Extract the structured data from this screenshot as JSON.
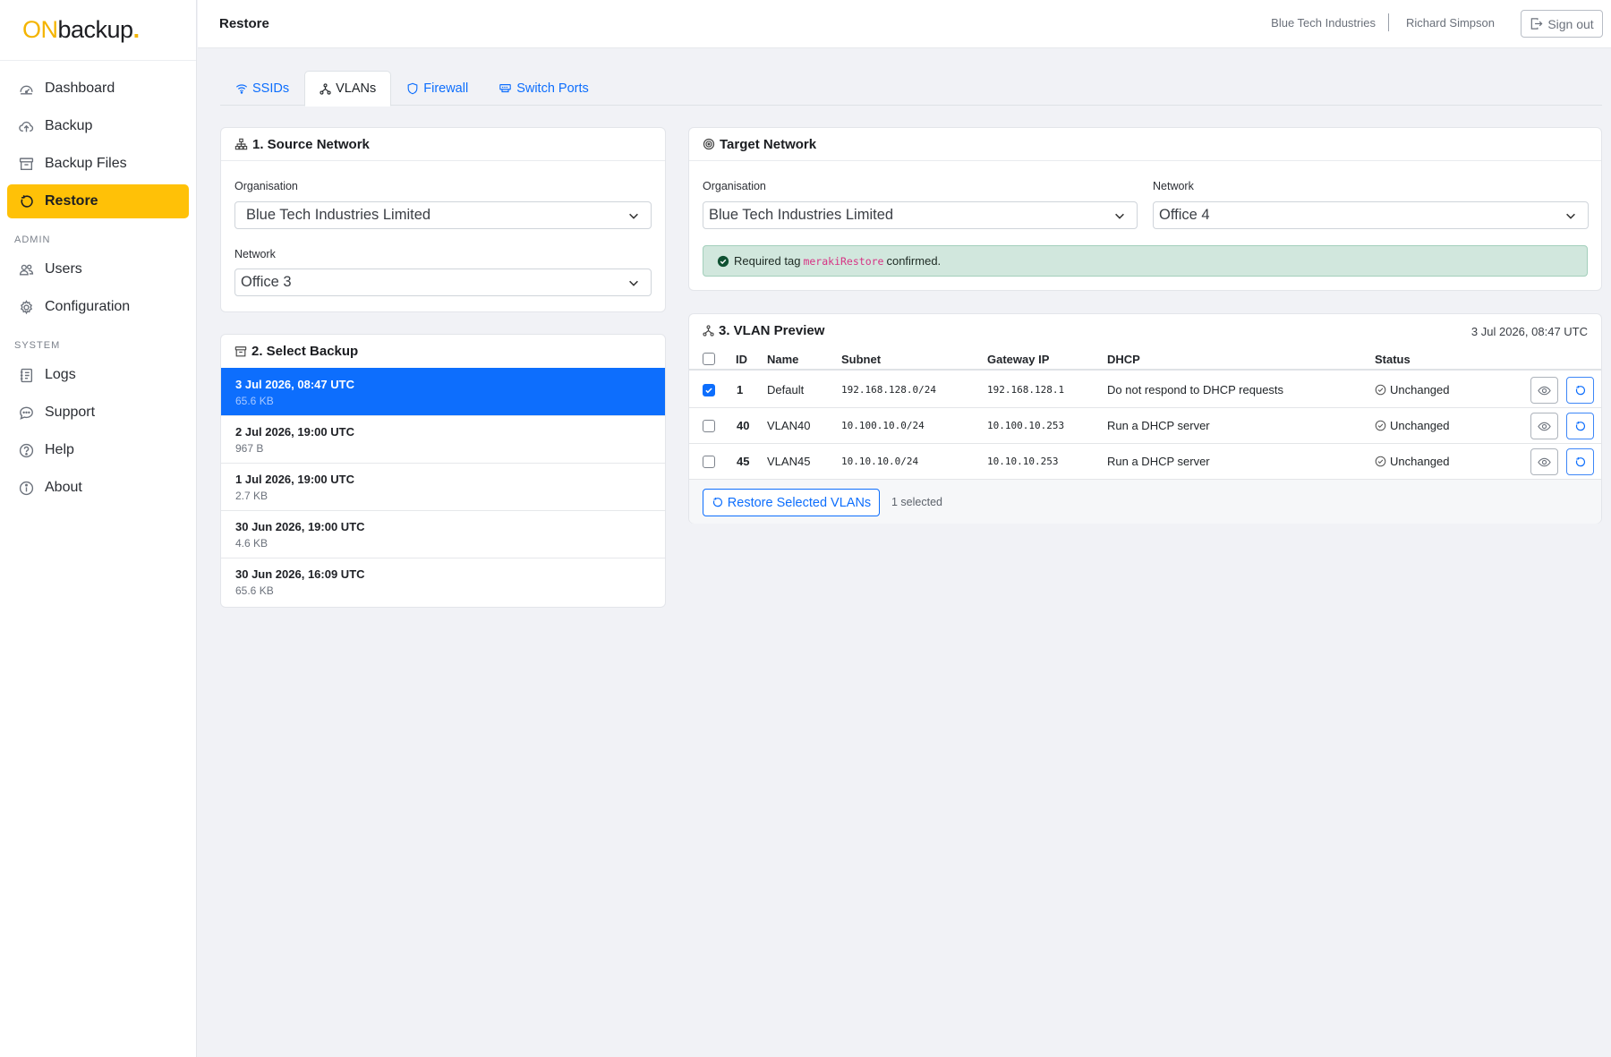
{
  "logo": {
    "on": "ON",
    "backup": "backup",
    "dot": "."
  },
  "sidebar": {
    "items": [
      {
        "label": "Dashboard",
        "icon": "dashboard-icon"
      },
      {
        "label": "Backup",
        "icon": "cloud-upload-icon"
      },
      {
        "label": "Backup Files",
        "icon": "archive-icon"
      },
      {
        "label": "Restore",
        "icon": "restore-icon",
        "active": true
      }
    ],
    "admin_label": "ADMIN",
    "admin_items": [
      {
        "label": "Users",
        "icon": "users-icon"
      },
      {
        "label": "Configuration",
        "icon": "gear-icon"
      }
    ],
    "system_label": "SYSTEM",
    "system_items": [
      {
        "label": "Logs",
        "icon": "journal-icon"
      },
      {
        "label": "Support",
        "icon": "chat-icon"
      },
      {
        "label": "Help",
        "icon": "question-circle-icon"
      },
      {
        "label": "About",
        "icon": "info-circle-icon"
      }
    ]
  },
  "header": {
    "title": "Restore",
    "organisation": "Blue Tech Industries",
    "user": "Richard Simpson",
    "signout": "Sign out"
  },
  "tabs": [
    {
      "label": "SSIDs",
      "icon": "wifi-icon"
    },
    {
      "label": "VLANs",
      "icon": "diagram-icon",
      "active": true
    },
    {
      "label": "Firewall",
      "icon": "shield-icon"
    },
    {
      "label": "Switch Ports",
      "icon": "ethernet-icon"
    }
  ],
  "source": {
    "title": "1. Source Network",
    "org_label": "Organisation",
    "org_value": "Blue Tech Industries Limited",
    "net_label": "Network",
    "net_value": "Office 3"
  },
  "backups": {
    "title": "2. Select Backup",
    "items": [
      {
        "date": "3 Jul 2026, 08:47 UTC",
        "size": "65.6 KB",
        "selected": true
      },
      {
        "date": "2 Jul 2026, 19:00 UTC",
        "size": "967 B"
      },
      {
        "date": "1 Jul 2026, 19:00 UTC",
        "size": "2.7 KB"
      },
      {
        "date": "30 Jun 2026, 19:00 UTC",
        "size": "4.6 KB"
      },
      {
        "date": "30 Jun 2026, 16:09 UTC",
        "size": "65.6 KB"
      }
    ]
  },
  "target": {
    "title": "Target Network",
    "org_label": "Organisation",
    "org_value": "Blue Tech Industries Limited",
    "net_label": "Network",
    "net_value": "Office 4",
    "alert_prefix": "Required tag",
    "alert_tag": "merakiRestore",
    "alert_suffix": "confirmed."
  },
  "vlans": {
    "title": "3. VLAN Preview",
    "timestamp": "3 Jul 2026, 08:47 UTC",
    "columns": {
      "id": "ID",
      "name": "Name",
      "subnet": "Subnet",
      "gateway": "Gateway IP",
      "dhcp": "DHCP",
      "status": "Status"
    },
    "rows": [
      {
        "checked": true,
        "id": "1",
        "name": "Default",
        "subnet": "192.168.128.0/24",
        "gateway": "192.168.128.1",
        "dhcp": "Do not respond to DHCP requests",
        "status": "Unchanged"
      },
      {
        "checked": false,
        "id": "40",
        "name": "VLAN40",
        "subnet": "10.100.10.0/24",
        "gateway": "10.100.10.253",
        "dhcp": "Run a DHCP server",
        "status": "Unchanged"
      },
      {
        "checked": false,
        "id": "45",
        "name": "VLAN45",
        "subnet": "10.10.10.0/24",
        "gateway": "10.10.10.253",
        "dhcp": "Run a DHCP server",
        "status": "Unchanged"
      }
    ],
    "restore_button": "Restore Selected VLANs",
    "selected_count": "1 selected"
  },
  "colors": {
    "accent": "#ffc107",
    "primary": "#0d6efd",
    "success_bg": "#d1e7dd",
    "tag": "#d63384"
  }
}
